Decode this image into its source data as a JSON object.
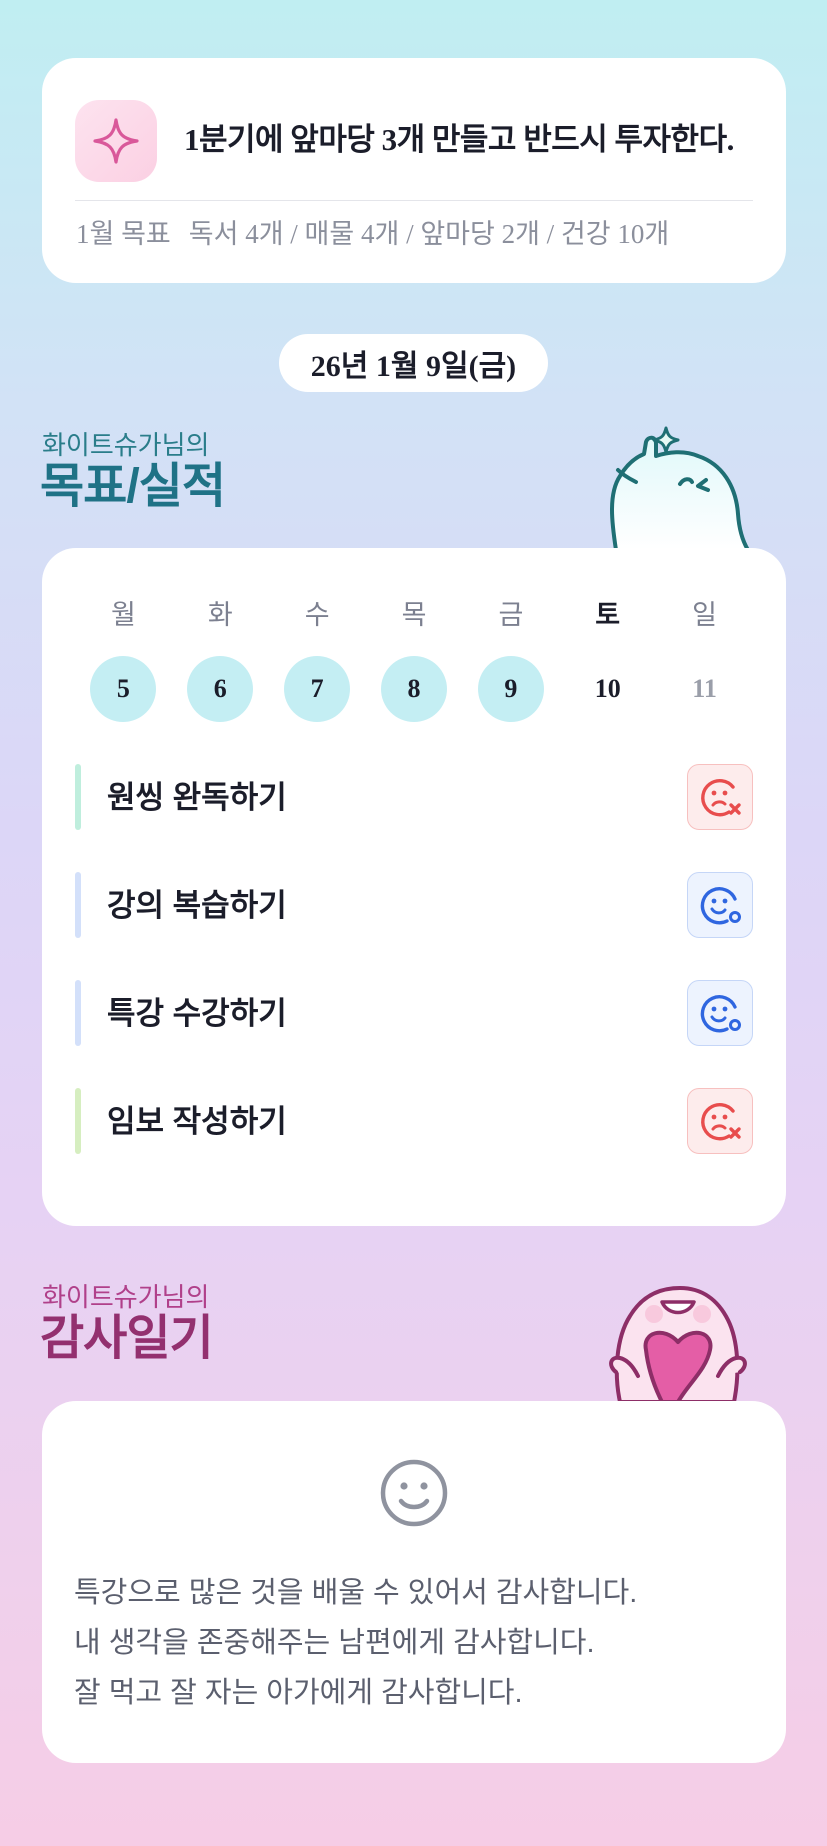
{
  "goal": {
    "icon": "sparkle-icon",
    "title": "1분기에 앞마당 3개 만들고 반드시 투자한다.",
    "monthly_label": "1월 목표",
    "monthly_items": "독서 4개 / 매물 4개 / 앞마당 2개 / 건강 10개"
  },
  "date": "26년 1월 9일(금)",
  "goals_section": {
    "subtitle": "화이트슈가님의",
    "title": "목표/실적",
    "days": [
      {
        "name": "월",
        "num": "5",
        "done": true
      },
      {
        "name": "화",
        "num": "6",
        "done": true
      },
      {
        "name": "수",
        "num": "7",
        "done": true
      },
      {
        "name": "목",
        "num": "8",
        "done": true
      },
      {
        "name": "금",
        "num": "9",
        "done": true
      },
      {
        "name": "토",
        "num": "10",
        "done": false
      },
      {
        "name": "일",
        "num": "11",
        "done": false
      }
    ],
    "tasks": [
      {
        "label": "원씽 완독하기",
        "status": "fail",
        "bar_color": "#bfeedd"
      },
      {
        "label": "강의 복습하기",
        "status": "ok",
        "bar_color": "#d3e0fa"
      },
      {
        "label": "특강 수강하기",
        "status": "ok",
        "bar_color": "#d3e0fa"
      },
      {
        "label": "임보 작성하기",
        "status": "fail",
        "bar_color": "#d6eec0"
      }
    ]
  },
  "thanks_section": {
    "subtitle": "화이트슈가님의",
    "title": "감사일기",
    "icon": "smiley-icon",
    "lines": [
      "특강으로 많은 것을 배울 수 있어서 감사합니다.",
      "내 생각을 존중해주는 남편에게 감사합니다.",
      "잘 먹고 잘 자는 아가에게 감사합니다."
    ]
  },
  "colors": {
    "fail": "#e84d4d",
    "ok": "#2f66e0",
    "done_day": "#c4eef3"
  }
}
